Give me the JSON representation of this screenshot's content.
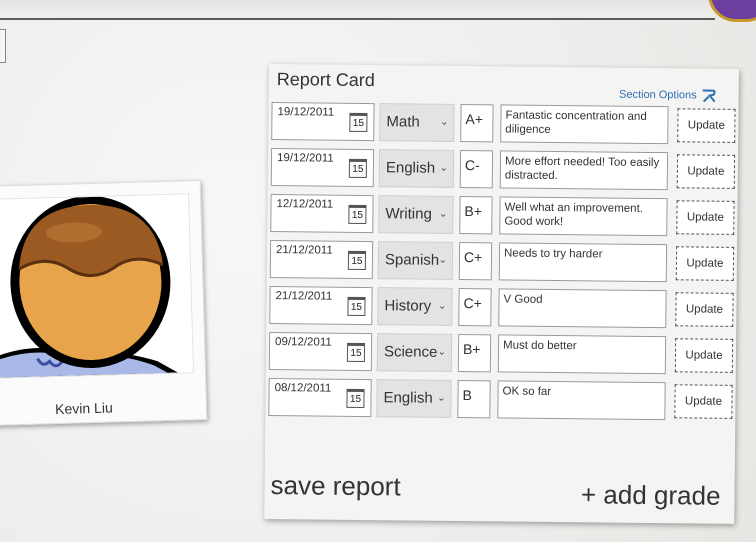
{
  "student": {
    "name": "Kevin Liu"
  },
  "report_card": {
    "title": "Report Card",
    "section_options": "Section Options",
    "calendar_day": "15",
    "update_label": "Update",
    "rows": [
      {
        "date": "19/12/2011",
        "subject": "Math",
        "grade": "A+",
        "comment": "Fantastic concentration and diligence"
      },
      {
        "date": "19/12/2011",
        "subject": "English",
        "grade": "C-",
        "comment": "More effort needed! Too easily distracted."
      },
      {
        "date": "12/12/2011",
        "subject": "Writing",
        "grade": "B+",
        "comment": "Well what an improvement. Good work!"
      },
      {
        "date": "21/12/2011",
        "subject": "Spanish",
        "grade": "C+",
        "comment": "Needs to try harder"
      },
      {
        "date": "21/12/2011",
        "subject": "History",
        "grade": "C+",
        "comment": "V Good"
      },
      {
        "date": "09/12/2011",
        "subject": "Science",
        "grade": "B+",
        "comment": "Must do better"
      },
      {
        "date": "08/12/2011",
        "subject": "English",
        "grade": "B",
        "comment": "OK so far"
      }
    ],
    "save_label": "save report",
    "add_label": "+ add grade"
  },
  "colors": {
    "accent": "#2f6db5",
    "badge": "#6b3fa0"
  }
}
